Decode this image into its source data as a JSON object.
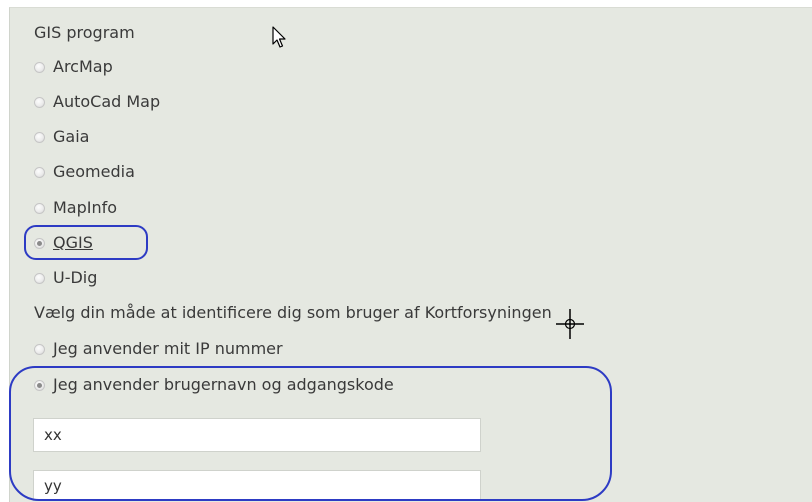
{
  "gis": {
    "heading": "GIS program",
    "options": [
      {
        "label": "ArcMap",
        "checked": false
      },
      {
        "label": "AutoCad Map",
        "checked": false
      },
      {
        "label": "Gaia",
        "checked": false
      },
      {
        "label": "Geomedia",
        "checked": false
      },
      {
        "label": "MapInfo",
        "checked": false
      },
      {
        "label": "QGIS",
        "checked": true
      },
      {
        "label": "U-Dig",
        "checked": false
      }
    ]
  },
  "identify": {
    "heading": "Vælg din måde at identificere dig som bruger af Kortforsyningen",
    "options": [
      {
        "label": "Jeg anvender mit IP nummer",
        "checked": false
      },
      {
        "label": "Jeg anvender brugernavn og adgangskode",
        "checked": true
      }
    ]
  },
  "fields": {
    "username_value": "xx",
    "password_value": "yy"
  },
  "colors": {
    "panel_background": "#e5e8e1",
    "annotation_outline": "#2d3bc4"
  },
  "icons": {
    "mouse_pointer": "arrow-cursor-icon",
    "crosshair": "crosshair-cursor-icon"
  }
}
